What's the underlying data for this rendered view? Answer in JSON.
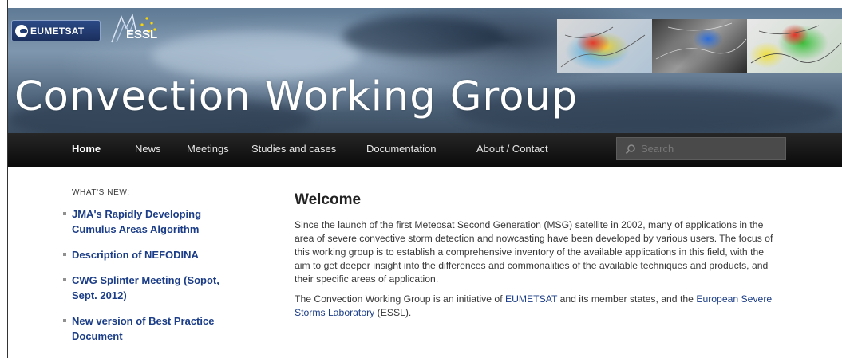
{
  "header": {
    "logo_eumetsat": "EUMETSAT",
    "logo_essl": "ESSL",
    "site_title": "Convection Working Group"
  },
  "nav": {
    "items": [
      {
        "label": "Home",
        "active": true
      },
      {
        "label": "News",
        "active": false
      },
      {
        "label": "Meetings",
        "active": false
      },
      {
        "label": "Studies and cases",
        "active": false
      },
      {
        "label": "Documentation",
        "active": false
      },
      {
        "label": "About / Contact",
        "active": false
      }
    ],
    "search_placeholder": "Search"
  },
  "sidebar": {
    "heading": "WHAT'S NEW:",
    "items": [
      {
        "label": "JMA's Rapidly Developing Cumulus Areas Algorithm"
      },
      {
        "label": "Description of NEFODINA"
      },
      {
        "label": "CWG Splinter Meeting (Sopot, Sept. 2012)"
      },
      {
        "label": "New version of Best Practice Document"
      }
    ]
  },
  "main": {
    "title": "Welcome",
    "paragraph1": "Since the launch of the first Meteosat Second Generation (MSG) satellite in 2002, many of applications in the area of severe convective storm detection and nowcasting have been developed by various users. The focus of this working group is to establish a comprehensive inventory of the available applications in this field, with the aim to get deeper insight into the differences and commonalities of the available techniques and products, and their specific areas of application.",
    "paragraph2_prefix": "The Convection Working Group is an initiative of ",
    "paragraph2_link1": "EUMETSAT",
    "paragraph2_middle": " and its member states, and the ",
    "paragraph2_link2": "European Severe Storms Laboratory",
    "paragraph2_suffix": " (ESSL)."
  },
  "colors": {
    "link": "#1b3d87",
    "nav_bg": "#111111",
    "search_bg": "#4a4a4a"
  }
}
